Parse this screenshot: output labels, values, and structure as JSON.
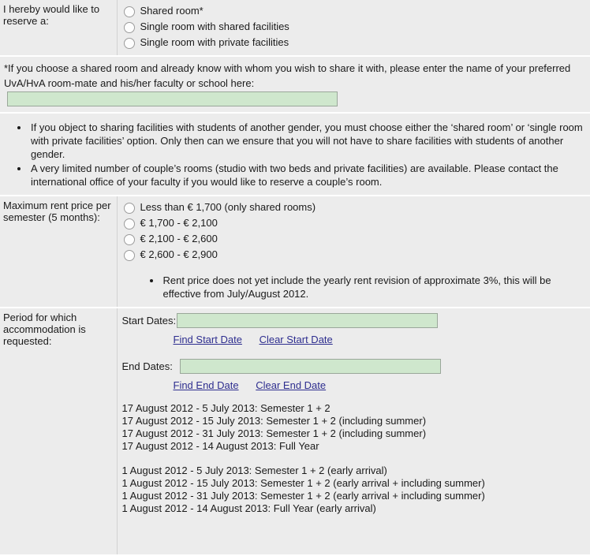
{
  "sections": {
    "reserve": {
      "label": "I hereby would like to reserve a:",
      "options": [
        "Shared room*",
        "Single room with shared facilities",
        "Single room with private facilities"
      ]
    },
    "roommate_note": {
      "text_before": "*If you choose a shared room and already know with whom you wish to share it with, please enter the name of your preferred UvA/HvA room-mate and his/her faculty or school here:",
      "input_value": "",
      "input_placeholder": ""
    },
    "gender_notes": {
      "bullets": [
        "If you object to sharing facilities with students of another gender, you must choose either the ‘shared room’ or ‘single room with private facilities’ option. Only then can we ensure that you will not have to share facilities with students of another gender.",
        "A very limited number of couple’s rooms (studio with two beds and private facilities) are available. Please contact the international office of your faculty if you would like to reserve a couple’s room."
      ]
    },
    "rent": {
      "label": "Maximum rent price per semester (5 months):",
      "options": [
        "Less than € 1,700 (only shared rooms)",
        "€ 1,700 - € 2,100",
        "€ 2,100 - € 2,600",
        "€ 2,600 - € 2,900"
      ],
      "bullets": [
        "Rent price does not yet include the yearly rent revision of approximate 3%, this will be effective from July/August 2012."
      ]
    },
    "period": {
      "label": "Period for which accommodation is requested:",
      "start_label": "Start Dates:",
      "start_value": "",
      "start_find_link": "Find Start Date",
      "start_clear_link": "Clear Start Date",
      "end_label": "End Dates:",
      "end_value": "",
      "end_find_link": "Find End Date",
      "end_clear_link": "Clear End Date",
      "date_groups": [
        [
          "17 August 2012 - 5 July 2013: Semester 1 + 2",
          "17 August 2012 - 15 July 2013: Semester 1 + 2 (including summer)",
          "17 August 2012 - 31 July 2013: Semester 1 + 2 (including summer)",
          "17 August 2012 - 14 August 2013: Full Year"
        ],
        [
          "1 August 2012 - 5 July 2013: Semester 1 + 2 (early arrival)",
          "1 August 2012 - 15 July 2013: Semester 1 + 2 (early arrival + including summer)",
          "1 August 2012 - 31 July 2013: Semester 1 + 2 (early arrival + including summer)",
          "1 August 2012 - 14 August 2013: Full Year (early arrival)"
        ]
      ]
    }
  },
  "colors": {
    "page_background": "#ececec",
    "input_fill": "#cfe7cd",
    "input_border": "#9aa79a",
    "link": "#2e2e8f",
    "divider": "#d2d2d2",
    "row_separator": "#ffffff"
  }
}
